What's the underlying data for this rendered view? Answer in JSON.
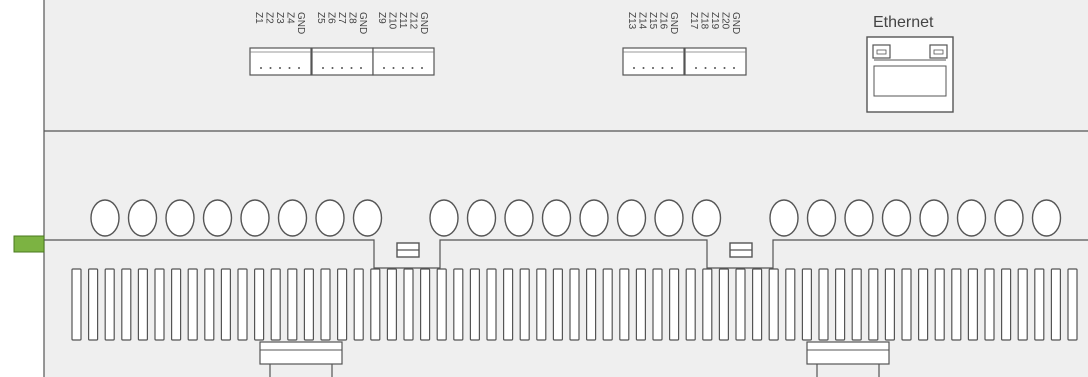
{
  "terminal_blocks": [
    {
      "id": "tb1",
      "labels": [
        "Z1",
        "Z2",
        "Z3",
        "Z4",
        "GND"
      ]
    },
    {
      "id": "tb2",
      "labels": [
        "Z5",
        "Z6",
        "Z7",
        "Z8",
        "GND"
      ]
    },
    {
      "id": "tb3",
      "labels": [
        "Z9",
        "Z10",
        "Z11",
        "Z12",
        "GND"
      ]
    },
    {
      "id": "tb4",
      "labels": [
        "Z13",
        "Z14",
        "Z15",
        "Z16",
        "GND"
      ]
    },
    {
      "id": "tb5",
      "labels": [
        "Z17",
        "Z18",
        "Z19",
        "Z20",
        "GND"
      ]
    }
  ],
  "ethernet": {
    "label": "Ethernet"
  },
  "led_groups": [
    8,
    8,
    8
  ],
  "vent_slots": 61,
  "colors": {
    "panel": "#efefef",
    "stroke": "#555555",
    "accent_green": "#7cb342"
  }
}
